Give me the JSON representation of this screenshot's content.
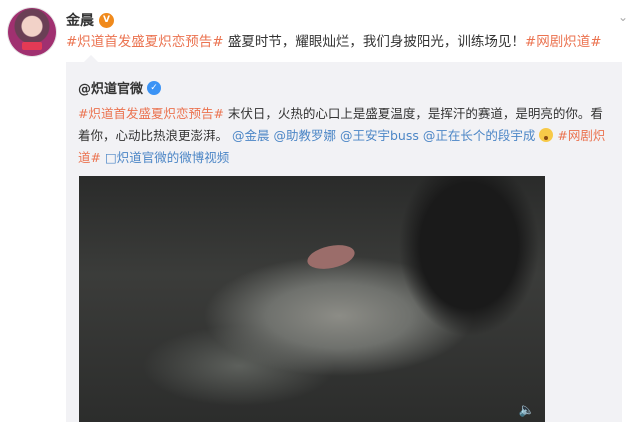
{
  "post": {
    "author": "金晨",
    "topic_1": "#炽道首发盛夏炽恋预告#",
    "text": " 盛夏时节，耀眼灿烂，我们身披阳光，训练场见！",
    "topic_2": "#网剧炽道#"
  },
  "repost": {
    "author": "@炽道官微",
    "topic_1": "#炽道首发盛夏炽恋预告#",
    "text_1": " 末伏日，火热的心口上是盛夏温度，是挥汗的赛道，是明亮的你。看着你，心动比热浪更澎湃。",
    "mention_1": "@金晨",
    "mention_2": "@助教罗娜",
    "mention_3": "@王安宇buss",
    "mention_4": "@正在长个的段宇成",
    "topic_2": "#网剧炽道#",
    "video_link": "炽道官微的微博视频"
  },
  "icons": {
    "vip": "vip-badge",
    "verified": "verified-badge",
    "more": "chevron-down",
    "emoji": "surprised-face",
    "link": "video-link",
    "mute": "speaker"
  },
  "colors": {
    "topic": "#eb7350",
    "link": "#4c86c6",
    "repost_bg": "#f2f2f5"
  }
}
